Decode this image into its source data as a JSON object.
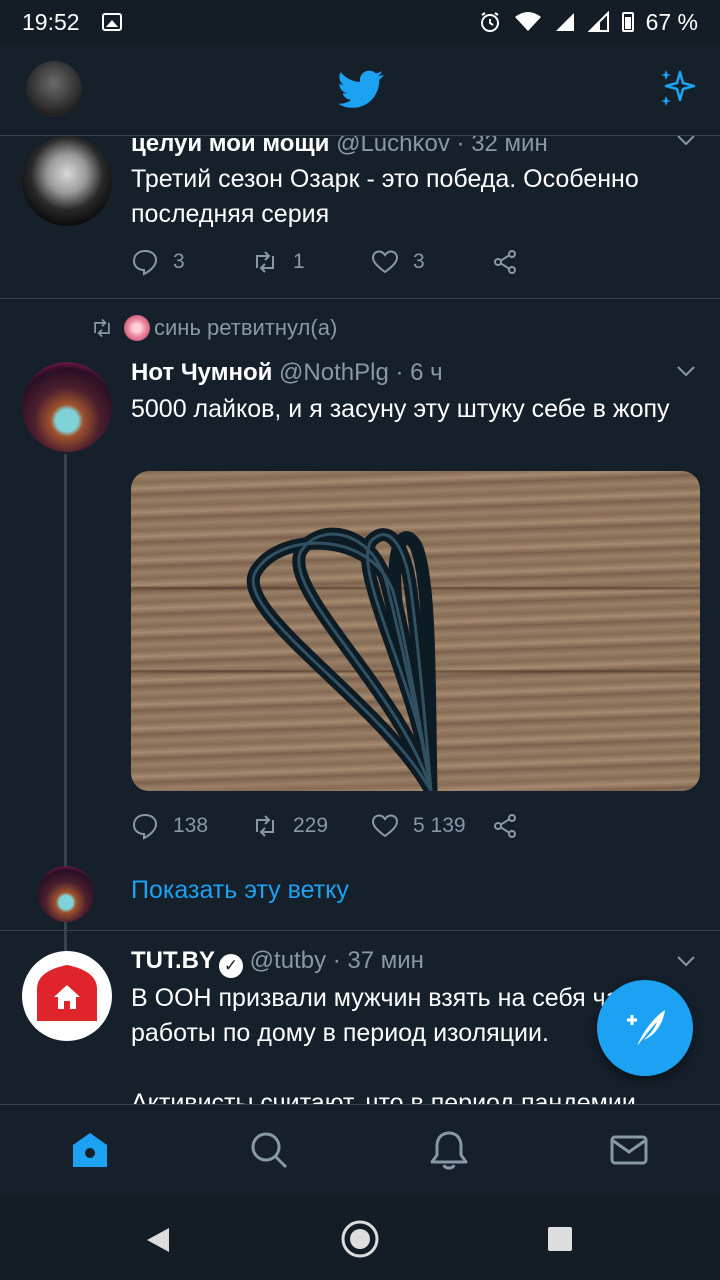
{
  "status_bar": {
    "time": "19:52",
    "battery": "67 %"
  },
  "app": {
    "icons": [
      "avatar",
      "twitter-bird-icon",
      "sparkle-icon"
    ],
    "accent": "#1da1f2"
  },
  "tweets": [
    {
      "name": "целуи мои мощи",
      "handle": "@Luchkov",
      "time": "· 32 мин",
      "text": "Третий сезон Озарк - это победа. Особенно последняя серия",
      "replies": "3",
      "retweets": "1",
      "likes": "3"
    },
    {
      "retweeted_by": "синь ретвитнул(а)",
      "name": "Нот Чумной",
      "handle": "@NothPlg",
      "time": "· 6 ч",
      "text": "5000 лайков, и я засуну эту штуку себе в жопу",
      "replies": "138",
      "retweets": "229",
      "likes": "5 139",
      "show_thread": "Показать эту ветку"
    },
    {
      "name": "TUT.BY",
      "handle": "@tutby",
      "time": "· 37 мин",
      "text": "В ООН призвали мужчин взять на себя часть работы по дому в период изоляции.",
      "text2": "Активисты считают, что в период пандемии"
    }
  ],
  "bottom_nav": [
    "home-icon",
    "search-icon",
    "notifications-icon",
    "messages-icon"
  ]
}
